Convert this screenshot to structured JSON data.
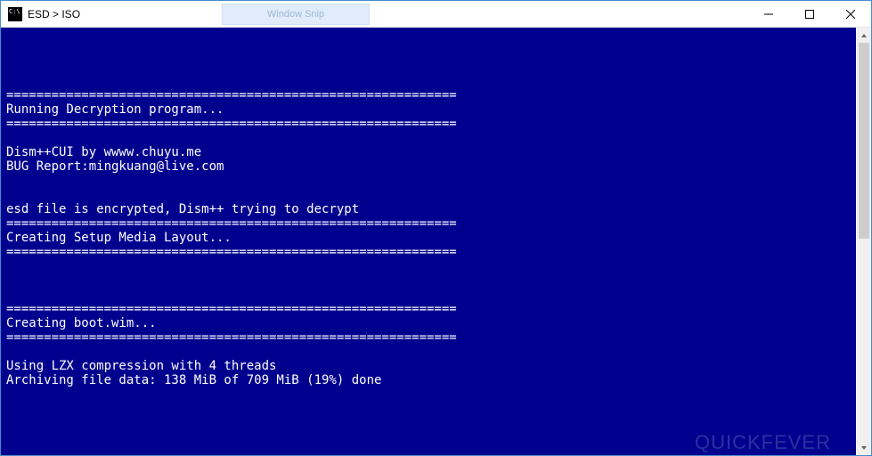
{
  "window": {
    "title": "ESD > ISO",
    "ghost_tab_label": "Window Snip"
  },
  "console": {
    "lines": [
      "",
      "",
      "============================================================",
      "Running Decryption program...",
      "============================================================",
      "",
      "Dism++CUI by wwww.chuyu.me",
      "BUG Report:mingkuang@live.com",
      "",
      "",
      "esd file is encrypted, Dism++ trying to decrypt",
      "============================================================",
      "Creating Setup Media Layout...",
      "============================================================",
      "",
      "",
      "",
      "============================================================",
      "Creating boot.wim...",
      "============================================================",
      "",
      "Using LZX compression with 4 threads",
      "Archiving file data: 138 MiB of 709 MiB (19%) done"
    ]
  },
  "watermark": {
    "light": "QUICK",
    "bold": "FEVER"
  }
}
